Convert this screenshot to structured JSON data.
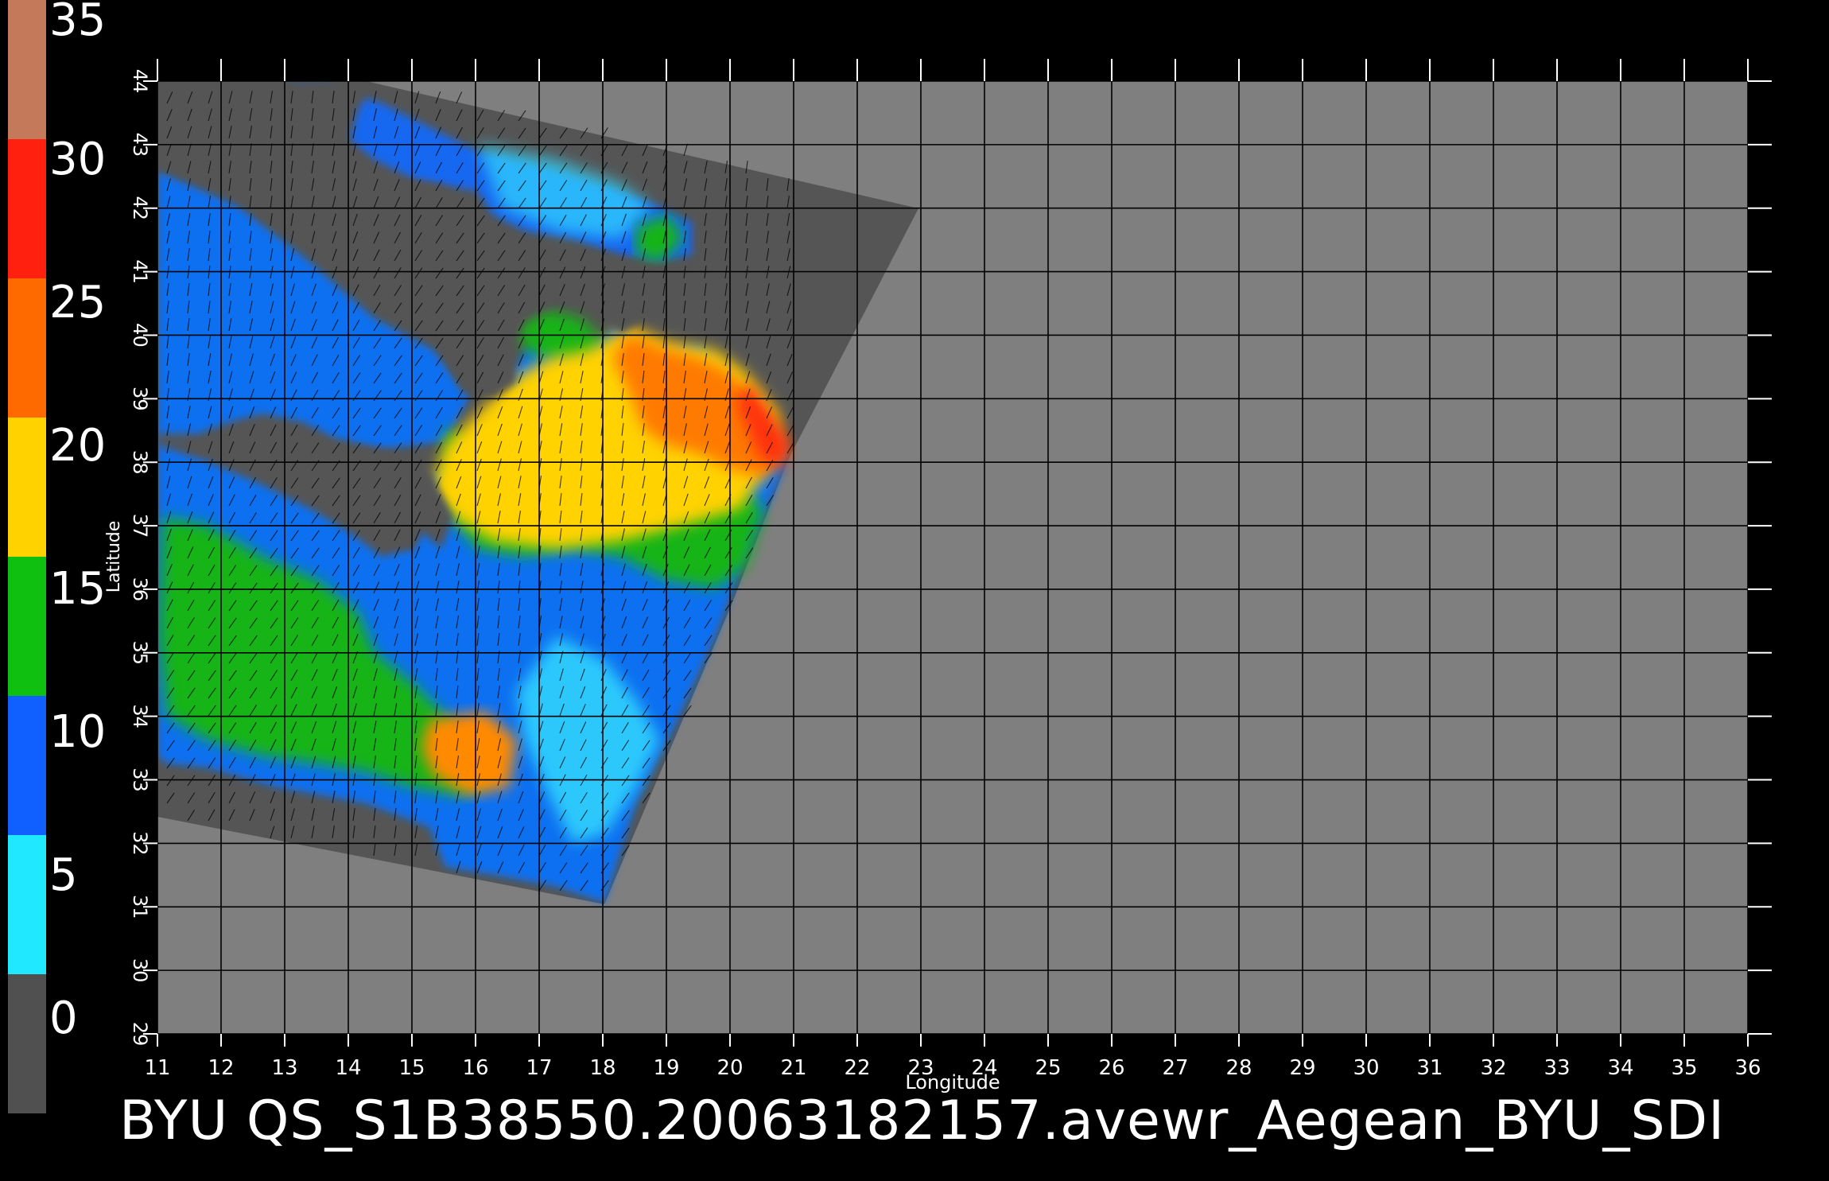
{
  "colorbar": {
    "labels": [
      "35",
      "30",
      "25",
      "20",
      "15",
      "10",
      "5",
      "0"
    ],
    "bands": [
      "#c47a5a",
      "#ff2010",
      "#ff6a00",
      "#ffd200",
      "#10c010",
      "#1060ff",
      "#20e8ff",
      "#505050"
    ]
  },
  "map": {
    "ylabel": "Latitude",
    "xlabel": "Longitude",
    "lon_ticks": [
      "11",
      "12",
      "13",
      "14",
      "15",
      "16",
      "17",
      "18",
      "19",
      "20",
      "21",
      "22",
      "23",
      "24",
      "25",
      "26",
      "27",
      "28",
      "29",
      "30",
      "31",
      "32",
      "33",
      "34",
      "35",
      "36"
    ],
    "lat_ticks": [
      "29",
      "30",
      "31",
      "32",
      "33",
      "34",
      "35",
      "36",
      "37",
      "38",
      "39",
      "40",
      "41",
      "42",
      "43",
      "44"
    ],
    "lon_range": [
      11,
      36
    ],
    "lat_range": [
      29,
      44
    ],
    "background_color": "#7f7f7f",
    "swath_color": "#555555",
    "grid": true
  },
  "caption": "BYU  QS_S1B38550.20063182157.avewr_Aegean_BYU_SDI"
}
